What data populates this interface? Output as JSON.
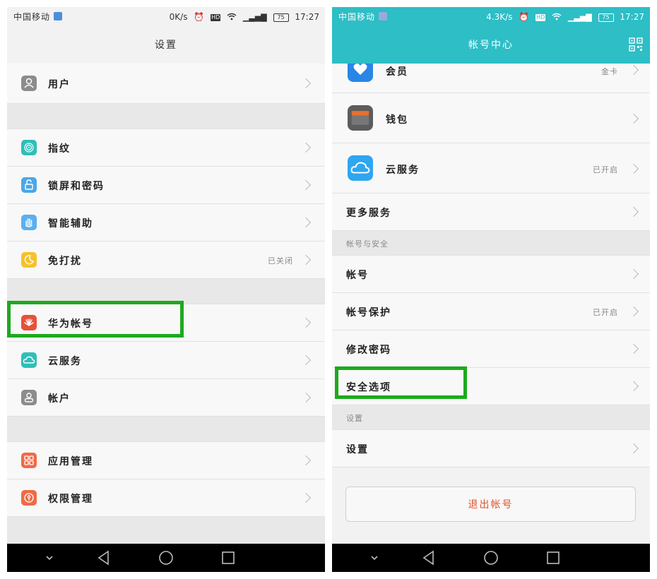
{
  "left": {
    "status": {
      "carrier": "中国移动",
      "speed": "0K/s",
      "battery": "75",
      "time": "17:27"
    },
    "title": "设置",
    "rows": {
      "user": {
        "label": "用户",
        "icon": "user-icon"
      },
      "fingerprint": {
        "label": "指纹",
        "icon": "fingerprint-icon"
      },
      "lockscreen": {
        "label": "锁屏和密码",
        "icon": "lock-icon"
      },
      "assist": {
        "label": "智能辅助",
        "icon": "hand-icon"
      },
      "dnd": {
        "label": "免打扰",
        "value": "已关闭",
        "icon": "moon-icon"
      },
      "huawei_account": {
        "label": "华为帐号",
        "icon": "huawei-logo-icon"
      },
      "cloud": {
        "label": "云服务",
        "icon": "cloud-icon"
      },
      "accounts": {
        "label": "帐户",
        "icon": "account-icon"
      },
      "apps": {
        "label": "应用管理",
        "icon": "apps-grid-icon"
      },
      "permissions": {
        "label": "权限管理",
        "icon": "permission-icon"
      }
    }
  },
  "right": {
    "status": {
      "carrier": "中国移动",
      "speed": "4.3K/s",
      "battery": "75",
      "time": "17:27"
    },
    "title": "帐号中心",
    "rows": {
      "member": {
        "label": "会员",
        "value": "金卡",
        "icon": "heart-shield-icon"
      },
      "wallet": {
        "label": "钱包",
        "icon": "wallet-icon"
      },
      "cloud": {
        "label": "云服务",
        "value": "已开启",
        "icon": "cloud-icon"
      },
      "more": {
        "label": "更多服务"
      },
      "account": {
        "label": "帐号"
      },
      "protect": {
        "label": "帐号保护",
        "value": "已开启"
      },
      "password": {
        "label": "修改密码"
      },
      "security": {
        "label": "安全选项"
      },
      "settings": {
        "label": "设置"
      }
    },
    "sections": {
      "account_security": "帐号与安全",
      "settings": "设置"
    },
    "logout": "退出帐号"
  },
  "colors": {
    "accent": "#2dbec6",
    "highlight": "#1ea91e",
    "logout_text": "#e0532d"
  }
}
